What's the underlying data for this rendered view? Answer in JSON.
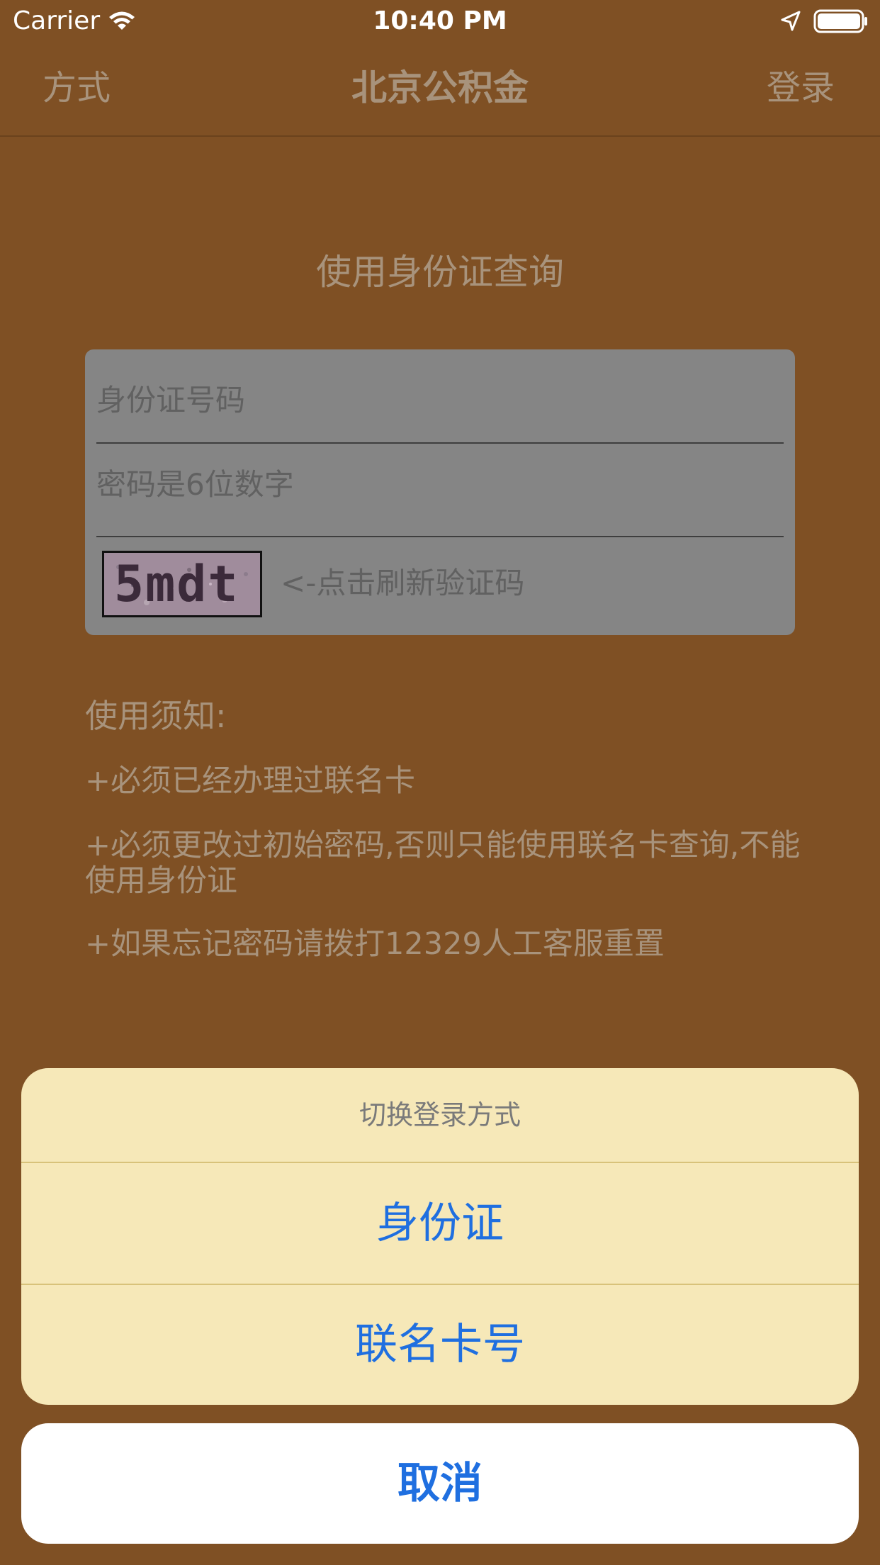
{
  "status_bar": {
    "carrier": "Carrier",
    "time": "10:40 PM",
    "icons": [
      "wifi-icon",
      "location-arrow-icon",
      "battery-icon"
    ]
  },
  "nav_bar": {
    "left_button": "方式",
    "title": "北京公积金",
    "right_button": "登录"
  },
  "main": {
    "subtitle": "使用身份证查询",
    "form": {
      "id_placeholder": "身份证号码",
      "password_placeholder": "密码是6位数字",
      "captcha_text": "5mdt",
      "captcha_hint": "<-点击刷新验证码"
    },
    "notice": {
      "title": "使用须知:",
      "items": [
        "+必须已经办理过联名卡",
        "+必须更改过初始密码,否则只能使用联名卡查询,不能使用身份证",
        "+如果忘记密码请拨打12329人工客服重置"
      ]
    }
  },
  "action_sheet": {
    "title": "切换登录方式",
    "options": [
      "身份证",
      "联名卡号"
    ],
    "cancel": "取消"
  },
  "colors": {
    "overlay_background": "#7f5024",
    "sheet_background": "#f6e8b8",
    "action_blue": "#1f6fe0"
  }
}
